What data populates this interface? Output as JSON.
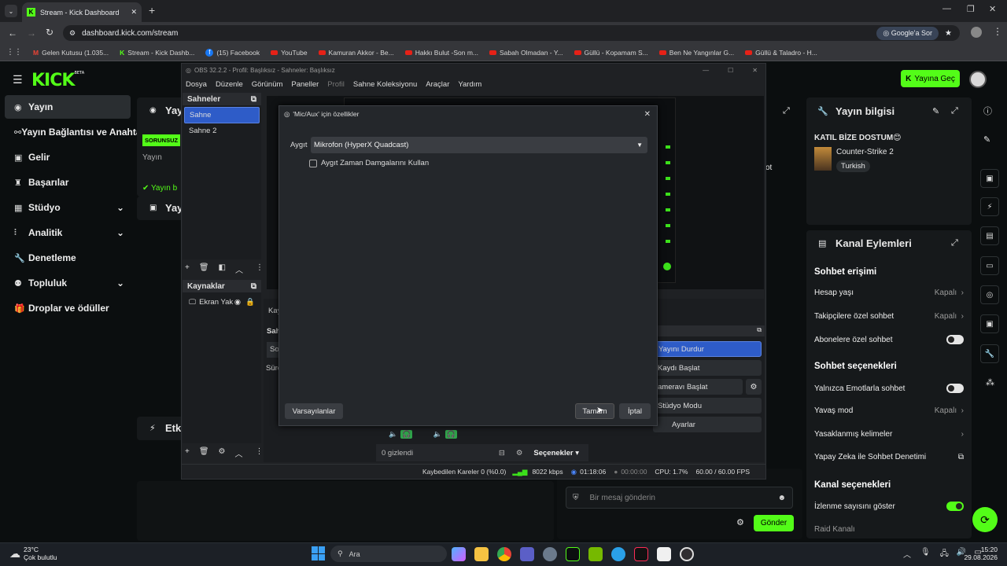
{
  "browser": {
    "tab_title": "Stream - Kick Dashboard",
    "url": "dashboard.kick.com/stream",
    "google_btn": "Google'a Sor",
    "bookmarks": [
      "Gelen Kutusu (1.035...",
      "Stream - Kick Dashb...",
      "(15) Facebook",
      "YouTube",
      "Kamuran Akkor - Be...",
      "Hakkı Bulut -Son m...",
      "Sabah Olmadan - Y...",
      "Güllü - Kopamam S...",
      "Ben Ne Yangınlar G...",
      "Güllü & Taladro - H..."
    ]
  },
  "kick": {
    "logo": "KICK",
    "beta": "BETA",
    "go_live": "Yayına Geç",
    "nav": [
      "Yayın",
      "Yayın Bağlantısı ve Anahtarı",
      "Gelir",
      "Başarılar",
      "Stüdyo",
      "Analitik",
      "Denetleme",
      "Topluluk",
      "Droplar ve ödüller"
    ],
    "stream_card_title": "Yay",
    "badge": "SORUNSUZ",
    "yayin_label": "Yayın",
    "yayin_status": "Yayın b",
    "yay2": "Yay",
    "etk": "Etk",
    "ot": "ot",
    "info_title": "Yayın bilgisi",
    "stream_title": "KATIL BİZE DOSTUM😊",
    "game": "Counter-Strike 2",
    "language": "Turkish",
    "actions_title": "Kanal Eylemleri",
    "chat_access": "Sohbet erişimi",
    "account_age": "Hesap yaşı",
    "account_age_val": "Kapalı",
    "followers_only": "Takipçilere özel sohbet",
    "followers_only_val": "Kapalı",
    "subs_only": "Abonelere özel sohbet",
    "chat_options": "Sohbet seçenekleri",
    "emotes_only": "Yalnızca Emotlarla sohbet",
    "slow_mode": "Yavaş mod",
    "slow_mode_val": "Kapalı",
    "banned_words": "Yasaklanmış kelimeler",
    "ai_moderation": "Yapay Zeka ile Sohbet Denetimi",
    "channel_options": "Kanal seçenekleri",
    "show_viewers": "İzlenme sayısını göster",
    "raid": "Raid Kanalı",
    "chat_placeholder": "Bir mesaj gönderin",
    "send": "Gönder"
  },
  "obs": {
    "title": "OBS 32.2.2 - Profil: Başlıksız - Sahneler: Başlıksız",
    "menu": [
      "Dosya",
      "Düzenle",
      "Görünüm",
      "Paneller",
      "Profil",
      "Sahne Koleksiyonu",
      "Araçlar",
      "Yardım"
    ],
    "scenes_header": "Sahneler",
    "scenes": [
      "Sahne",
      "Sahne 2"
    ],
    "sources_header": "Kaynaklar",
    "source": "Ekran Yak",
    "kaybed": "Kaybed",
    "sah": "Sah",
    "sol": "Sol",
    "sure": "Süre",
    "controls": [
      "Yayını Durdur",
      "Kaydı Başlat",
      "ameravı Başlat",
      "Stüdyo Modu",
      "Ayarlar"
    ],
    "hidden": "0 gizlendi",
    "options": "Seçenekler",
    "status": {
      "dropped": "Kaybedilen Kareler 0 (%0.0)",
      "bitrate": "8022 kbps",
      "live_time": "01:18:06",
      "rec_time": "00:00:00",
      "cpu": "CPU: 1.7%",
      "fps": "60.00 / 60.00 FPS"
    }
  },
  "dialog": {
    "title": "'Mic/Aux' için özellikler",
    "device_label": "Aygıt",
    "device_value": "Mikrofon (HyperX Quadcast)",
    "checkbox_label": "Aygıt Zaman Damgalarını Kullan",
    "defaults": "Varsayılanlar",
    "ok": "Tamam",
    "cancel": "İptal"
  },
  "taskbar": {
    "temp": "23°C",
    "weather": "Çok bulutlu",
    "search": "Ara",
    "time": "15:20",
    "date": "29.08.2026"
  }
}
